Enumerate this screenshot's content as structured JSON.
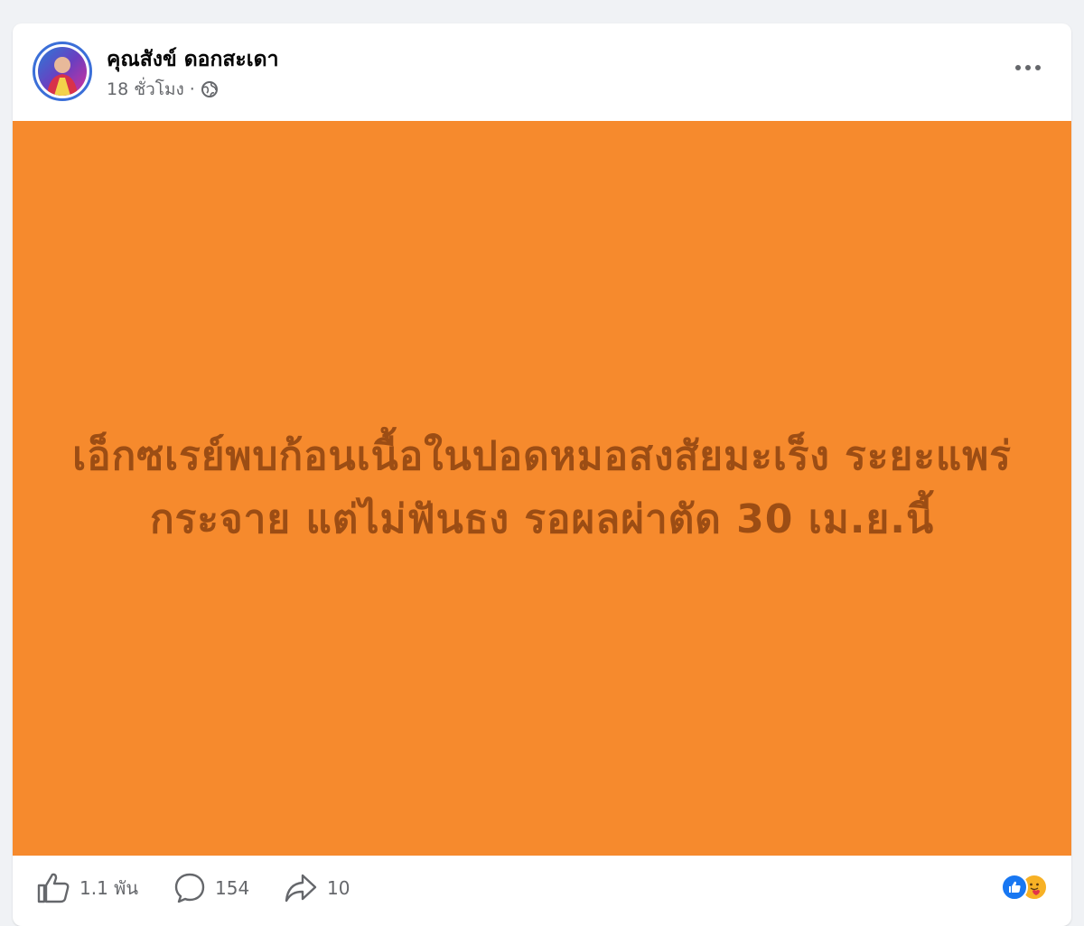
{
  "post": {
    "author": {
      "name": "คุณสังข์ ดอกสะเดา"
    },
    "timestamp": "18 ชั่วโมง",
    "separator": "·",
    "privacy_icon": "globe-icon",
    "image_text": "เอ็กซเรย์พบก้อนเนื้อในปอดหมอสงสัยมะเร็ง ระยะแพร่กระจาย แต่ไม่ฟันธง รอผลผ่าตัด 30 เม.ย.นี้",
    "image_background": "#f68a2d",
    "image_text_color": "#9c4d14"
  },
  "actions": {
    "like_count": "1.1 พัน",
    "comment_count": "154",
    "share_count": "10"
  },
  "reactions": {
    "icons": [
      "like-reaction-icon",
      "care-reaction-icon"
    ],
    "like_color": "#1877f2",
    "care_color": "#f7b125"
  }
}
